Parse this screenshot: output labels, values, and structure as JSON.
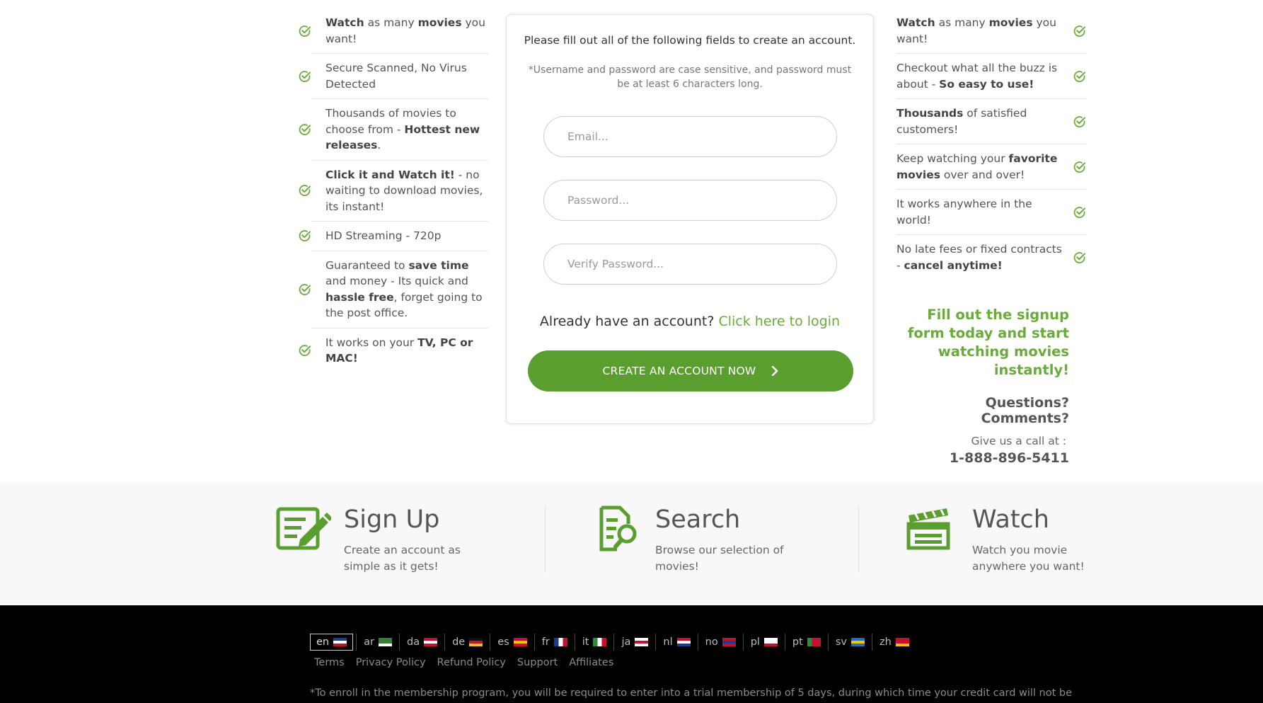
{
  "left_features": [
    {
      "parts": [
        {
          "t": "Watch",
          "b": true
        },
        {
          "t": " as many "
        },
        {
          "t": "movies",
          "b": true
        },
        {
          "t": " you want!"
        }
      ]
    },
    {
      "parts": [
        {
          "t": "Secure Scanned, No Virus Detected"
        }
      ]
    },
    {
      "parts": [
        {
          "t": "Thousands of movies to choose from - "
        },
        {
          "t": "Hottest new releases",
          "b": true
        },
        {
          "t": "."
        }
      ]
    },
    {
      "parts": [
        {
          "t": "Click it and Watch it!",
          "b": true
        },
        {
          "t": " - no waiting to download movies, its instant!"
        }
      ]
    },
    {
      "parts": [
        {
          "t": "HD Streaming - 720p"
        }
      ]
    },
    {
      "parts": [
        {
          "t": "Guaranteed to "
        },
        {
          "t": "save time",
          "b": true
        },
        {
          "t": " and money - Its quick and "
        },
        {
          "t": "hassle free",
          "b": true
        },
        {
          "t": ", forget going to the post office."
        }
      ]
    },
    {
      "parts": [
        {
          "t": "It works on your "
        },
        {
          "t": "TV, PC or MAC!",
          "b": true
        }
      ]
    }
  ],
  "right_features": [
    {
      "parts": [
        {
          "t": "Watch",
          "b": true
        },
        {
          "t": " as many "
        },
        {
          "t": "movies",
          "b": true
        },
        {
          "t": " you want!"
        }
      ]
    },
    {
      "parts": [
        {
          "t": "Checkout what all the buzz is about - "
        },
        {
          "t": "So easy to use!",
          "b": true
        }
      ]
    },
    {
      "parts": [
        {
          "t": "Thousands",
          "b": true
        },
        {
          "t": " of satisfied customers!"
        }
      ]
    },
    {
      "parts": [
        {
          "t": "Keep watching your "
        },
        {
          "t": "favorite movies",
          "b": true
        },
        {
          "t": " over and over!"
        }
      ]
    },
    {
      "parts": [
        {
          "t": "It works anywhere in the world!"
        }
      ]
    },
    {
      "parts": [
        {
          "t": "No late fees or fixed contracts - "
        },
        {
          "t": "cancel anytime!",
          "b": true
        }
      ]
    }
  ],
  "form": {
    "lead": "Please fill out all of the following fields to create an account.",
    "note": "*Username and password are case sensitive, and password must be at least 6 characters long.",
    "email_placeholder": "Email...",
    "password_placeholder": "Password...",
    "verify_placeholder": "Verify Password...",
    "login_prompt": "Already have an account?",
    "login_link": "Click here to login",
    "cta_label": "CREATE AN ACCOUNT NOW"
  },
  "promo": {
    "headline": "Fill out the signup form today and start watching movies instantly!",
    "questions": "Questions? Comments?",
    "call_label": "Give us a call at :",
    "phone": "1-888-896-5411"
  },
  "steps": [
    {
      "title": "Sign Up",
      "desc": "Create an account as simple as it gets!",
      "icon": "signup-icon"
    },
    {
      "title": "Search",
      "desc": "Browse our selection of movies!",
      "icon": "search-doc-icon"
    },
    {
      "title": "Watch",
      "desc": "Watch you movie anywhere you want!",
      "icon": "clapperboard-icon"
    }
  ],
  "footer": {
    "languages": [
      "en",
      "ar",
      "da",
      "de",
      "es",
      "fr",
      "it",
      "ja",
      "nl",
      "no",
      "pl",
      "pt",
      "sv",
      "zh"
    ],
    "active_language": "en",
    "links": [
      "Terms",
      "Privacy Policy",
      "Refund Policy",
      "Support",
      "Affiliates"
    ],
    "disclaimer": "*To enroll in the membership program, you will be required to enter into a trial membership of 5 days, during which time your credit card will not be"
  },
  "colors": {
    "accent": "#6aab3c",
    "button": "#5a9e2f",
    "footer_bg": "#000000"
  }
}
